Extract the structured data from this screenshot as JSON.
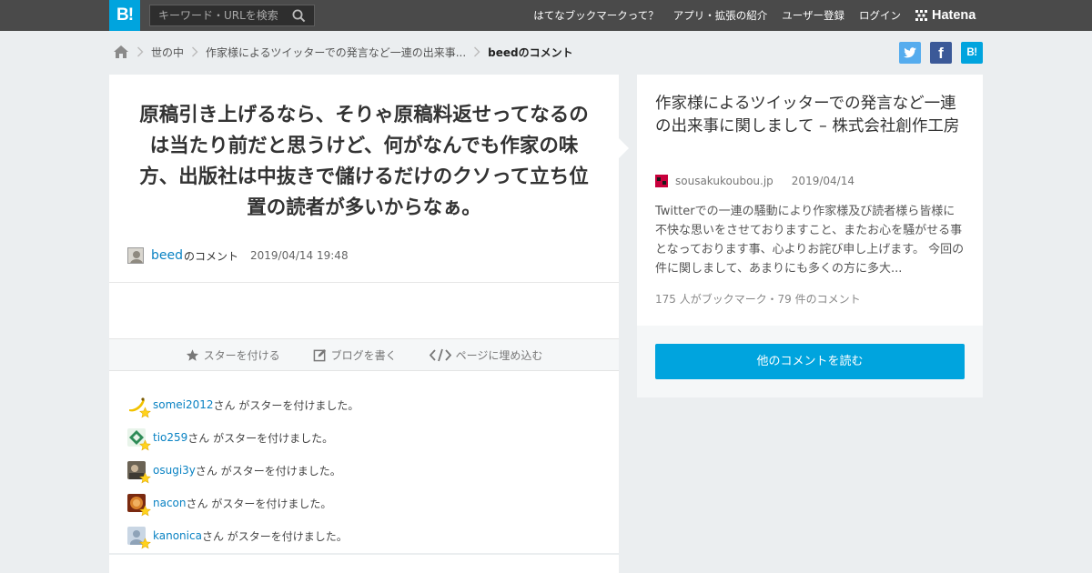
{
  "header": {
    "logo": "B!",
    "search_placeholder": "キーワード・URLを検索",
    "nav": [
      "はてなブックマークって？",
      "アプリ・拡張の紹介",
      "ユーザー登録",
      "ログイン"
    ],
    "brand": "Hatena"
  },
  "breadcrumb": {
    "category": "世の中",
    "entry": "作家様によるツイッターでの発言など一連の出来事...",
    "current": "beedのコメント"
  },
  "share": {
    "facebook": "f",
    "hatena": "B!"
  },
  "comment": {
    "text": "原稿引き上げるなら、そりゃ原稿料返せってなるのは当たり前だと思うけど、何がなんでも作家の味方、出版社は中抜きで儲けるだけのクソって立ち位置の読者が多いからなぁ。",
    "user": "beed",
    "user_suffix": "のコメント",
    "date": "2019/04/14 19:48"
  },
  "actions": {
    "star": "スターを付ける",
    "blog": "ブログを書く",
    "embed": "ページに埋め込む"
  },
  "stars": [
    {
      "user": "somei2012",
      "suffix": "さん がスターを付けました。"
    },
    {
      "user": "tio259",
      "suffix": "さん がスターを付けました。"
    },
    {
      "user": "osugi3y",
      "suffix": "さん がスターを付けました。"
    },
    {
      "user": "nacon",
      "suffix": "さん がスターを付けました。"
    },
    {
      "user": "kanonica",
      "suffix": "さん がスターを付けました。"
    }
  ],
  "entry": {
    "title": "作家様によるツイッターでの発言など一連の出来事に関しまして – 株式会社創作工房",
    "domain": "sousakukoubou.jp",
    "date": "2019/04/14",
    "summary": "Twitterでの一連の騒動により作家様及び読者様ら皆様に不快な思いをさせておりますこと、またお心を騒がせる事となっております事、心よりお詫び申し上げます。 今回の件に関しまして、あまりにも多くの方に多大...",
    "stats": "175 人がブックマーク・79 件のコメント",
    "read_more": "他のコメントを読む"
  },
  "colors": {
    "accent": "#00a4de",
    "link": "#0982c3",
    "header": "#4a4a4a",
    "star": "#ffd21c"
  }
}
